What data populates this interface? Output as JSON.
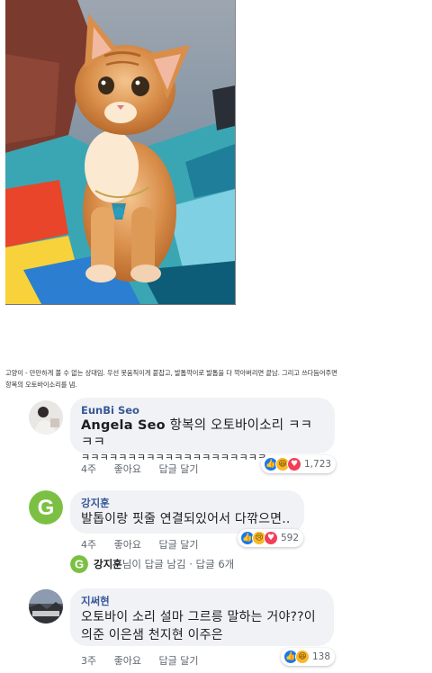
{
  "caption": {
    "line1": "고양이 - 만만하게 볼 수 없는 상대임. 우선 못움직이게 붙잡고, 발톱깍이로 발톱을 다 깍아버리면 끝남. 그리고 쓰다듬어주면",
    "line2": "항복의 오토바이소리를 냄."
  },
  "comments": [
    {
      "author": "EunBi Seo",
      "tag": "Angela Seo",
      "text1": " 항복의 오토바이소리 ㅋㅋㅋㅋ",
      "text2": "ㅋㅋㅋㅋㅋㅋㅋㅋㅋㅋㅋㅋㅋㅋㅋㅋㅋㅋㅋㅋ",
      "time": "4주",
      "like": "좋아요",
      "reply": "답글 달기",
      "reactions": "1,723"
    },
    {
      "author": "강지훈",
      "text1": "발톱이랑 핏줄 연결되있어서 다깎으면..",
      "time": "4주",
      "like": "좋아요",
      "reply": "답글 달기",
      "reactions": "592"
    },
    {
      "author": "지써현",
      "text1": "오토바이 소리 설마 그르릉 말하는 거야??이",
      "text2": "의준 이은샘 천지현 이주은",
      "time": "3주",
      "like": "좋아요",
      "reply": "답글 달기",
      "reactions": "138"
    }
  ],
  "reply_summary": {
    "name": "강지훈",
    "text": "님이 답글 남김 · 답글 6개"
  },
  "colors": {
    "bubble": "#f0f2f5",
    "like_blue": "#1877f2",
    "author_blue": "#385898",
    "green_logo": "#7cc043"
  }
}
